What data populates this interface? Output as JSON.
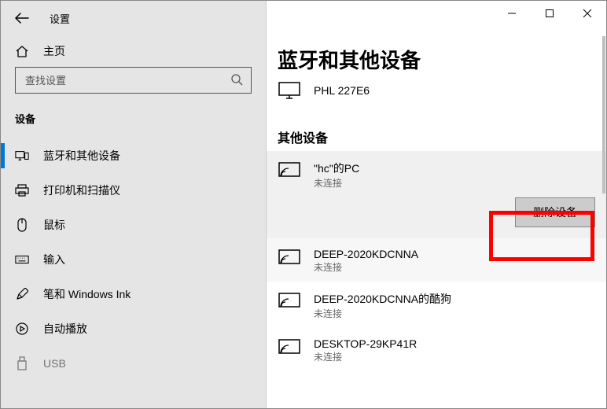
{
  "app": {
    "title": "设置"
  },
  "home": {
    "label": "主页"
  },
  "search": {
    "placeholder": "查找设置"
  },
  "section": {
    "label": "设备"
  },
  "nav": [
    {
      "key": "bluetooth",
      "label": "蓝牙和其他设备",
      "selected": true
    },
    {
      "key": "printers",
      "label": "打印机和扫描仪"
    },
    {
      "key": "mouse",
      "label": "鼠标"
    },
    {
      "key": "typing",
      "label": "输入"
    },
    {
      "key": "pen",
      "label": "笔和 Windows Ink"
    },
    {
      "key": "autoplay",
      "label": "自动播放"
    },
    {
      "key": "usb",
      "label": "USB"
    }
  ],
  "page": {
    "title": "蓝牙和其他设备"
  },
  "monitor": {
    "name": "PHL 227E6"
  },
  "other": {
    "heading": "其他设备"
  },
  "devices": [
    {
      "name": "\"hc\"的PC",
      "status": "未连接",
      "state": "selected"
    },
    {
      "name": "DEEP-2020KDCNNA",
      "status": "未连接",
      "state": "secondary"
    },
    {
      "name": "DEEP-2020KDCNNA的酷狗",
      "status": "未连接",
      "state": ""
    },
    {
      "name": "DESKTOP-29KP41R",
      "status": "未连接",
      "state": ""
    }
  ],
  "remove": {
    "label": "删除设备"
  }
}
